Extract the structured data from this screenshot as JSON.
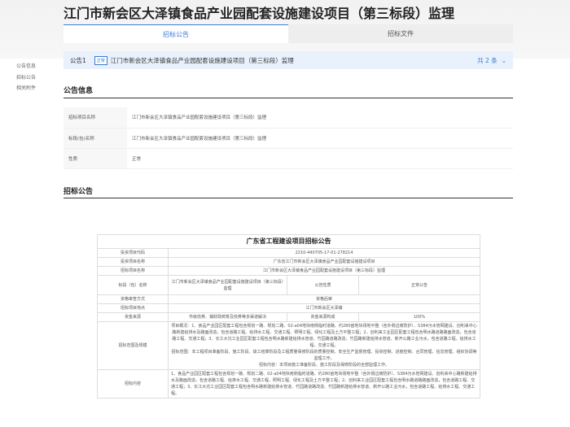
{
  "title": "江门市新会区大泽镇食品产业园配套设施建设项目（第三标段）监理",
  "tabs": [
    {
      "label": "招标公告",
      "active": true
    },
    {
      "label": "招标文件",
      "active": false
    }
  ],
  "sidebar": [
    "公告信息",
    "招标公告",
    "相关附件"
  ],
  "notice": {
    "label": "公告1",
    "badge": "正常",
    "text": "江门市新会区大泽镇食品产业园配套设施建设项目（第三标段）监理",
    "count": "共 2 条"
  },
  "info_heading": "公告信息",
  "info": [
    {
      "label": "招标项目名称",
      "value": "江门市新会区大泽镇食品产业园配套设施建设项目（第三标段）监理"
    },
    {
      "label": "标段(包)名称",
      "value": "江门市新会区大泽镇食品产业园配套设施建设项目（第三标段）监理"
    },
    {
      "label": "性质",
      "value": "正常"
    }
  ],
  "notice_heading": "招标公告",
  "doc": {
    "title": "广东省工程建设项目招标公告",
    "code_label": "投资项目代码",
    "code": "2210-440705-17-01-278214",
    "invest_label": "投资项目名称",
    "invest": "广东省江门市新会区大泽镇食品产业园配套设施建设项目",
    "proj_label": "招标项目名称",
    "proj": "江门市新会区大泽镇食品产业园配套设施建设项目（第三标段）监理",
    "section_label": "标段（包）名称",
    "section": "江门市新会区大泽镇食品产业园配套设施建设项目（第三标段）监理",
    "nature_label": "公告性质",
    "nature": "正常公告",
    "review_label": "资格审查方式",
    "review": "资格后审",
    "place_label": "招标项目地点",
    "place": "江门市新会区大泽镇",
    "fund_label": "资金来源",
    "fund": "市级债券、镇财政统筹及债券等多渠道解决",
    "ratio_label": "资金来源构成",
    "ratio": "100%",
    "scope_label": "招标范围及规模",
    "scope1": "项目概况：1、食品产业园区配套工程包含规划一路、规划二路、02-a04地块南侧临时道路、约280亩地块场地平整（含外侧边坡防护）、S384污水管网建设、创利来中心路新建给排水及路面改造，包含道路工程、给排水工程、交通工程、照明工程、绿化工程及土方平整工程；2、创利来工业园区配套工程包含明水路道路路面改造，包含道路工程、交通工程；3、长江大坑工业园区配套工程包含明水路新建给排水管道、竹园路道路改造、竹园路新建给排水管道、新开公路工业污水，包含道路工程、给排水工程、交通工程。",
    "scope2": "招标范围：本工程项目准备阶段、施工阶段、竣工结算阶段及工程质量保修阶段的质量控制、安全生产监督管理、投资控制、进度控制、合同管理、信息管理、组织协调等监理工作。",
    "scope3": "招标内容：本项目施工准备阶段、施工阶段及保修阶段的全部监理工作。",
    "content_label": "招标内容",
    "content": "1、食品产业园区配套工程包含规划一路、规划二路、02-a04地块南侧临时道路、约280亩地块场地平整（含外侧边坡防护）、S384污水管网建设、创利来中心路新建给排水及路面改造，包含道路工程、给排水工程、交通工程、照明工程、绿化工程及土方平整工程；2、创利来工业园区配套工程包含明水路道路路面改造，包含道路工程、交通工程；3、长江大坑工业园区配套工程包含明水路新建给排水管道、竹园路道路改造、竹园路新建给排水管道、新开公路工业污水，包含道路工程、给排水工程、交通工程。"
  },
  "colors": {
    "accent": "#3a7bd5",
    "notice_bg": "#e8f1fc"
  }
}
